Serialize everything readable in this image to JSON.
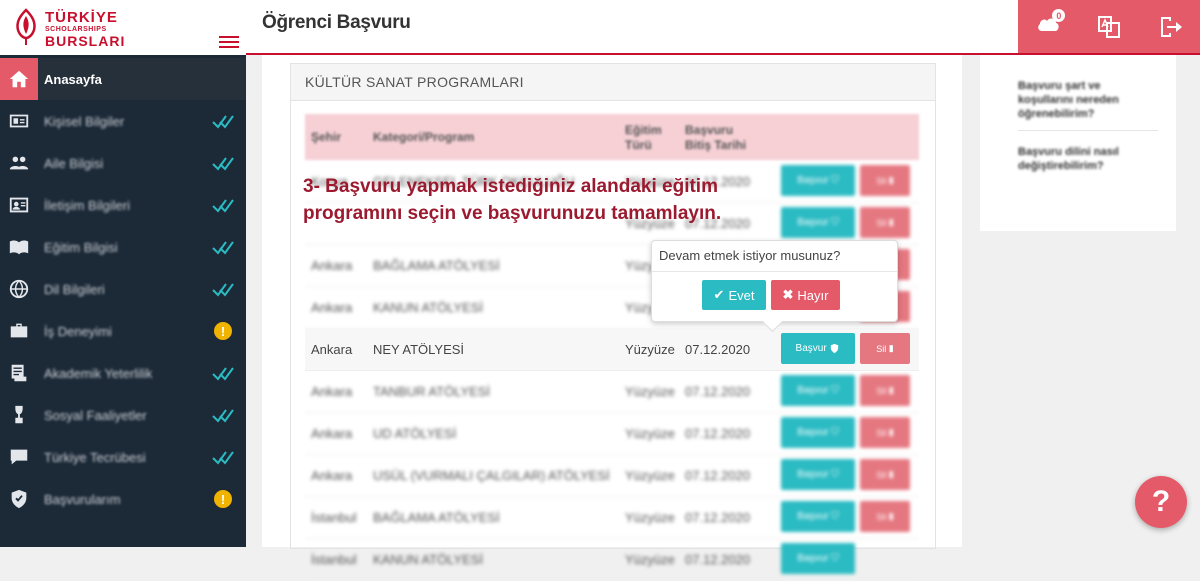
{
  "logo": {
    "line1": "TÜRKİYE",
    "line2": "SCHOLARSHIPS",
    "line3": "BURSLARI"
  },
  "header": {
    "title": "Öğrenci Başvuru"
  },
  "sidebar": {
    "items": [
      {
        "label": "Anasayfa",
        "icon": "home-icon",
        "status": "none"
      },
      {
        "label": "Kişisel Bilgiler",
        "icon": "id-card-icon",
        "status": "check"
      },
      {
        "label": "Aile Bilgisi",
        "icon": "family-icon",
        "status": "check"
      },
      {
        "label": "İletişim Bilgileri",
        "icon": "contact-card-icon",
        "status": "check"
      },
      {
        "label": "Eğitim Bilgisi",
        "icon": "book-icon",
        "status": "check"
      },
      {
        "label": "Dil Bilgileri",
        "icon": "globe-icon",
        "status": "check"
      },
      {
        "label": "İş Deneyimi",
        "icon": "briefcase-icon",
        "status": "warning"
      },
      {
        "label": "Akademik Yeterlilik",
        "icon": "document-icon",
        "status": "check"
      },
      {
        "label": "Sosyal Faaliyetler",
        "icon": "trophy-icon",
        "status": "check"
      },
      {
        "label": "Türkiye Tecrübesi",
        "icon": "chat-icon",
        "status": "check"
      },
      {
        "label": "Başvurularım",
        "icon": "shield-check-icon",
        "status": "warning"
      }
    ]
  },
  "main": {
    "card_title": "KÜLTÜR SANAT PROGRAMLARI",
    "columns": {
      "city": "Şehir",
      "program": "Kategori/Program",
      "edu1": "Eğitim",
      "edu2": "Türü",
      "dl1": "Başvuru",
      "dl2": "Bitiş Tarihi"
    },
    "apply_label": "Başvur",
    "delete_label": "Sil",
    "rows": [
      {
        "city": "Konya",
        "program": "GELENEKSEL TÜRK OKÇULUĞU",
        "type": "Yüzyüze",
        "deadline": "07.12.2020"
      },
      {
        "city": "",
        "program": "",
        "type": "Yüzyüze",
        "deadline": "07.12.2020"
      },
      {
        "city": "Ankara",
        "program": "BAĞLAMA ATÖLYESİ",
        "type": "Yüzyüze",
        "deadline": ""
      },
      {
        "city": "Ankara",
        "program": "KANUN ATÖLYESİ",
        "type": "Yüzyüze",
        "deadline": ""
      },
      {
        "city": "Ankara",
        "program": "NEY ATÖLYESİ",
        "type": "Yüzyüze",
        "deadline": "07.12.2020"
      },
      {
        "city": "Ankara",
        "program": "TANBUR ATÖLYESİ",
        "type": "Yüzyüze",
        "deadline": "07.12.2020"
      },
      {
        "city": "Ankara",
        "program": "UD ATÖLYESİ",
        "type": "Yüzyüze",
        "deadline": "07.12.2020"
      },
      {
        "city": "Ankara",
        "program": "USÜL (VURMALI ÇALGILAR) ATÖLYESİ",
        "type": "Yüzyüze",
        "deadline": "07.12.2020"
      },
      {
        "city": "İstanbul",
        "program": "BAĞLAMA ATÖLYESİ",
        "type": "Yüzyüze",
        "deadline": "07.12.2020"
      },
      {
        "city": "İstanbul",
        "program": "KANUN ATÖLYESİ",
        "type": "Yüzyüze",
        "deadline": "07.12.2020"
      }
    ]
  },
  "instruction": {
    "line1": "3- Başvuru yapmak istediğiniz alandaki eğitim",
    "line2": "programını seçin ve başvurunuzu tamamlayın."
  },
  "popover": {
    "question": "Devam etmek istiyor musunuz?",
    "yes": "Evet",
    "no": "Hayır"
  },
  "faq": [
    "Başvuru şart ve koşullarını nereden öğrenebilirim?",
    "Başvuru dilini nasıl değiştirebilirim?"
  ],
  "header_actions": {
    "notification_count": "0"
  },
  "help_label": "?",
  "colors": {
    "accent": "#e55a69",
    "brand": "#c8102e",
    "teal": "#2bbbc3",
    "sidebar": "#1c2a38"
  }
}
